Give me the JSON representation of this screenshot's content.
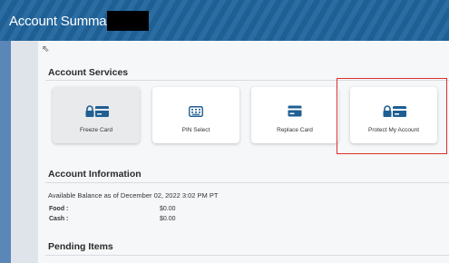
{
  "header": {
    "title": "Account Summary For",
    "redaction_color": "#000000"
  },
  "account_services": {
    "title": "Account Services",
    "cards": [
      {
        "label": "Freeze Card",
        "icon": "lock-card-icon",
        "selected": true
      },
      {
        "label": "PIN Select",
        "icon": "keypad-icon",
        "selected": false
      },
      {
        "label": "Replace Card",
        "icon": "card-icon",
        "selected": false
      },
      {
        "label": "Protect My Account",
        "icon": "lock-card-icon",
        "selected": false,
        "highlighted": true
      }
    ]
  },
  "account_information": {
    "title": "Account Information",
    "balance_line": "Available Balance as of December 02, 2022 3:02 PM PT",
    "balances": [
      {
        "label": "Food :",
        "value": "$0.00"
      },
      {
        "label": "Cash :",
        "value": "$0.00"
      }
    ]
  },
  "pending_items": {
    "title": "Pending Items"
  },
  "colors": {
    "header_blue": "#1f5f93",
    "accent_icon": "#1f5f93",
    "highlight_border": "#d8312f"
  }
}
